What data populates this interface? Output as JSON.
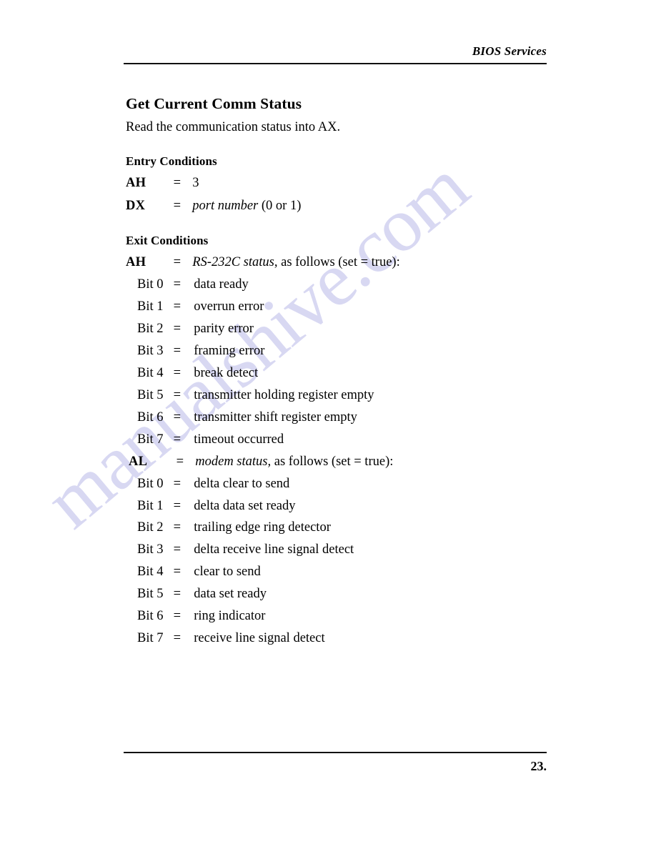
{
  "document": {
    "running_head": "BIOS Services",
    "page_number": "23.",
    "watermark": "manualshive.com",
    "watermark_color": "#d6d6f2",
    "text_color": "#000000",
    "background_color": "#ffffff"
  },
  "section": {
    "title": "Get Current Comm Status",
    "lead": "Read the communication status into AX."
  },
  "entry_conditions": {
    "heading": "Entry Conditions",
    "rows": [
      {
        "register": "AH",
        "equals": "=",
        "value": "3",
        "value_italic": ""
      },
      {
        "register": "DX",
        "equals": "=",
        "value_italic": "port number",
        "value": " (0 or 1)"
      }
    ]
  },
  "exit_conditions": {
    "heading": "Exit Conditions",
    "registers": [
      {
        "register": "AH",
        "equals": "=",
        "value_italic": "RS-232C status",
        "value": ", as follows (set  =  true):",
        "bits": [
          {
            "label": "Bit 0",
            "equals": "=",
            "desc": "data ready"
          },
          {
            "label": "Bit 1",
            "equals": "=",
            "desc": "overrun error"
          },
          {
            "label": "Bit 2",
            "equals": "=",
            "desc": "parity error"
          },
          {
            "label": "Bit 3",
            "equals": "=",
            "desc": "framing error"
          },
          {
            "label": "Bit 4",
            "equals": "=",
            "desc": "break detect"
          },
          {
            "label": "Bit 5",
            "equals": "=",
            "desc": "transmitter holding register empty"
          },
          {
            "label": "Bit 6",
            "equals": "=",
            "desc": "transmitter shift register empty"
          },
          {
            "label": "Bit 7",
            "equals": "=",
            "desc": "timeout occurred"
          }
        ]
      },
      {
        "register": "AL",
        "equals": "=",
        "value_italic": "modem status,",
        "value": " as follows (set  =  true):",
        "bits": [
          {
            "label": "Bit 0",
            "equals": "=",
            "desc": "delta clear to send"
          },
          {
            "label": "Bit 1",
            "equals": "=",
            "desc": "delta data set ready"
          },
          {
            "label": "Bit 2",
            "equals": "=",
            "desc": "trailing edge ring detector"
          },
          {
            "label": "Bit 3",
            "equals": "=",
            "desc": "delta receive line signal detect"
          },
          {
            "label": "Bit 4",
            "equals": "=",
            "desc": "clear to send"
          },
          {
            "label": "Bit 5",
            "equals": "=",
            "desc": "data set ready"
          },
          {
            "label": "Bit 6",
            "equals": "=",
            "desc": "ring indicator"
          },
          {
            "label": "Bit 7",
            "equals": "=",
            "desc": "receive line signal detect"
          }
        ]
      }
    ]
  }
}
